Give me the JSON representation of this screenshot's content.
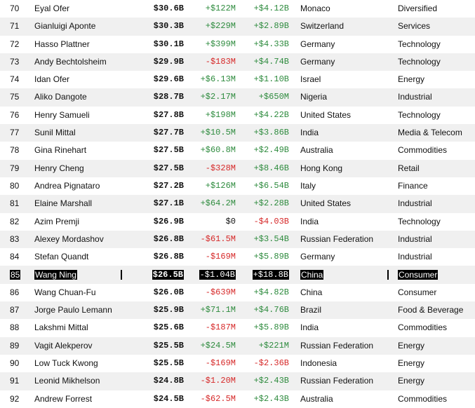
{
  "columns": [
    "rank",
    "name",
    "net_worth",
    "last_change",
    "ytd_change",
    "country",
    "industry"
  ],
  "rows": [
    {
      "rank": "70",
      "name": "Eyal Ofer",
      "worth": "$30.6B",
      "daily": "+$122M",
      "daily_sign": "pos",
      "ytd": "+$4.12B",
      "ytd_sign": "pos",
      "country": "Monaco",
      "industry": "Diversified"
    },
    {
      "rank": "71",
      "name": "Gianluigi Aponte",
      "worth": "$30.3B",
      "daily": "+$229M",
      "daily_sign": "pos",
      "ytd": "+$2.89B",
      "ytd_sign": "pos",
      "country": "Switzerland",
      "industry": "Services"
    },
    {
      "rank": "72",
      "name": "Hasso Plattner",
      "worth": "$30.1B",
      "daily": "+$399M",
      "daily_sign": "pos",
      "ytd": "+$4.33B",
      "ytd_sign": "pos",
      "country": "Germany",
      "industry": "Technology"
    },
    {
      "rank": "73",
      "name": "Andy Bechtolsheim",
      "worth": "$29.9B",
      "daily": "-$183M",
      "daily_sign": "neg",
      "ytd": "+$4.74B",
      "ytd_sign": "pos",
      "country": "Germany",
      "industry": "Technology"
    },
    {
      "rank": "74",
      "name": "Idan Ofer",
      "worth": "$29.6B",
      "daily": "+$6.13M",
      "daily_sign": "pos",
      "ytd": "+$1.10B",
      "ytd_sign": "pos",
      "country": "Israel",
      "industry": "Energy"
    },
    {
      "rank": "75",
      "name": "Aliko Dangote",
      "worth": "$28.7B",
      "daily": "+$2.17M",
      "daily_sign": "pos",
      "ytd": "+$650M",
      "ytd_sign": "pos",
      "country": "Nigeria",
      "industry": "Industrial"
    },
    {
      "rank": "76",
      "name": "Henry Samueli",
      "worth": "$27.8B",
      "daily": "+$198M",
      "daily_sign": "pos",
      "ytd": "+$4.22B",
      "ytd_sign": "pos",
      "country": "United States",
      "industry": "Technology"
    },
    {
      "rank": "77",
      "name": "Sunil Mittal",
      "worth": "$27.7B",
      "daily": "+$10.5M",
      "daily_sign": "pos",
      "ytd": "+$3.86B",
      "ytd_sign": "pos",
      "country": "India",
      "industry": "Media & Telecom"
    },
    {
      "rank": "78",
      "name": "Gina Rinehart",
      "worth": "$27.5B",
      "daily": "+$60.8M",
      "daily_sign": "pos",
      "ytd": "+$2.49B",
      "ytd_sign": "pos",
      "country": "Australia",
      "industry": "Commodities"
    },
    {
      "rank": "79",
      "name": "Henry Cheng",
      "worth": "$27.5B",
      "daily": "-$328M",
      "daily_sign": "neg",
      "ytd": "+$8.46B",
      "ytd_sign": "pos",
      "country": "Hong Kong",
      "industry": "Retail"
    },
    {
      "rank": "80",
      "name": "Andrea Pignataro",
      "worth": "$27.2B",
      "daily": "+$126M",
      "daily_sign": "pos",
      "ytd": "+$6.54B",
      "ytd_sign": "pos",
      "country": "Italy",
      "industry": "Finance"
    },
    {
      "rank": "81",
      "name": "Elaine Marshall",
      "worth": "$27.1B",
      "daily": "+$64.2M",
      "daily_sign": "pos",
      "ytd": "+$2.28B",
      "ytd_sign": "pos",
      "country": "United States",
      "industry": "Industrial"
    },
    {
      "rank": "82",
      "name": "Azim Premji",
      "worth": "$26.9B",
      "daily": "$0",
      "daily_sign": "zero",
      "ytd": "-$4.03B",
      "ytd_sign": "neg",
      "country": "India",
      "industry": "Technology"
    },
    {
      "rank": "83",
      "name": "Alexey Mordashov",
      "worth": "$26.8B",
      "daily": "-$61.5M",
      "daily_sign": "neg",
      "ytd": "+$3.54B",
      "ytd_sign": "pos",
      "country": "Russian Federation",
      "industry": "Industrial"
    },
    {
      "rank": "84",
      "name": "Stefan Quandt",
      "worth": "$26.8B",
      "daily": "-$169M",
      "daily_sign": "neg",
      "ytd": "+$5.89B",
      "ytd_sign": "pos",
      "country": "Germany",
      "industry": "Industrial"
    },
    {
      "rank": "85",
      "name": "Wang Ning",
      "worth": "$26.5B",
      "daily": "-$1.04B",
      "daily_sign": "neg",
      "ytd": "+$18.8B",
      "ytd_sign": "pos",
      "country": "China",
      "industry": "Consumer",
      "highlighted": true
    },
    {
      "rank": "86",
      "name": "Wang Chuan-Fu",
      "worth": "$26.0B",
      "daily": "-$639M",
      "daily_sign": "neg",
      "ytd": "+$4.82B",
      "ytd_sign": "pos",
      "country": "China",
      "industry": "Consumer"
    },
    {
      "rank": "87",
      "name": "Jorge Paulo Lemann",
      "worth": "$25.9B",
      "daily": "+$71.1M",
      "daily_sign": "pos",
      "ytd": "+$4.76B",
      "ytd_sign": "pos",
      "country": "Brazil",
      "industry": "Food & Beverage"
    },
    {
      "rank": "88",
      "name": "Lakshmi Mittal",
      "worth": "$25.6B",
      "daily": "-$187M",
      "daily_sign": "neg",
      "ytd": "+$5.89B",
      "ytd_sign": "pos",
      "country": "India",
      "industry": "Commodities"
    },
    {
      "rank": "89",
      "name": "Vagit Alekperov",
      "worth": "$25.5B",
      "daily": "+$24.5M",
      "daily_sign": "pos",
      "ytd": "+$221M",
      "ytd_sign": "pos",
      "country": "Russian Federation",
      "industry": "Energy"
    },
    {
      "rank": "90",
      "name": "Low Tuck Kwong",
      "worth": "$25.5B",
      "daily": "-$169M",
      "daily_sign": "neg",
      "ytd": "-$2.36B",
      "ytd_sign": "neg",
      "country": "Indonesia",
      "industry": "Energy"
    },
    {
      "rank": "91",
      "name": "Leonid Mikhelson",
      "worth": "$24.8B",
      "daily": "-$1.20M",
      "daily_sign": "neg",
      "ytd": "+$2.43B",
      "ytd_sign": "pos",
      "country": "Russian Federation",
      "industry": "Energy"
    },
    {
      "rank": "92",
      "name": "Andrew Forrest",
      "worth": "$24.5B",
      "daily": "-$62.5M",
      "daily_sign": "neg",
      "ytd": "+$2.43B",
      "ytd_sign": "pos",
      "country": "Australia",
      "industry": "Commodities"
    }
  ],
  "colors": {
    "positive": "#2e8b3e",
    "negative": "#d62828",
    "row_stripe": "#f0f0f0",
    "highlight_bg": "#000000",
    "highlight_fg": "#ffffff"
  }
}
